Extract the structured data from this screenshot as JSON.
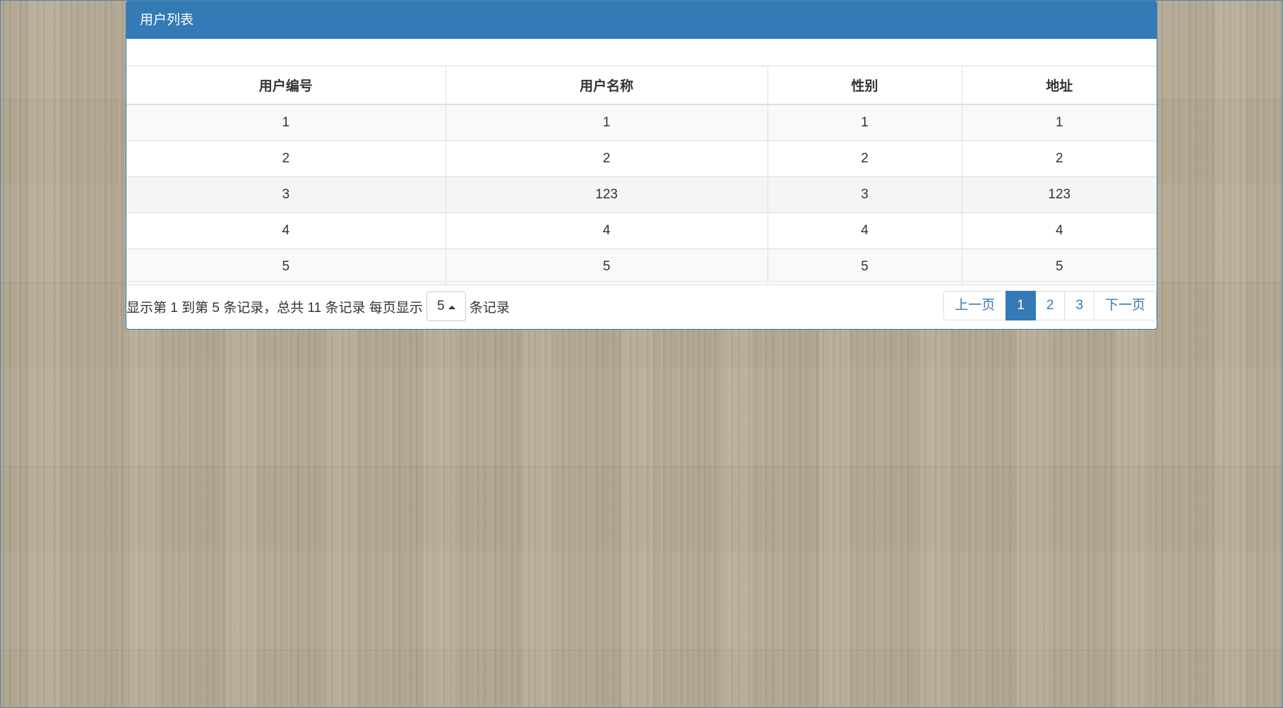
{
  "panel": {
    "title": "用户列表"
  },
  "table": {
    "columns": [
      "用户编号",
      "用户名称",
      "性别",
      "地址"
    ],
    "rows": [
      [
        "1",
        "1",
        "1",
        "1"
      ],
      [
        "2",
        "2",
        "2",
        "2"
      ],
      [
        "3",
        "123",
        "3",
        "123"
      ],
      [
        "4",
        "4",
        "4",
        "4"
      ],
      [
        "5",
        "5",
        "5",
        "5"
      ]
    ]
  },
  "pagination": {
    "summary_text": "显示第 1 到第 5 条记录，总共 11 条记录 每页显示",
    "page_size": "5",
    "suffix_text": "条记录",
    "prev_label": "上一页",
    "pages": [
      "1",
      "2",
      "3"
    ],
    "active_page": "1",
    "next_label": "下一页"
  },
  "colors": {
    "primary": "#337ab7",
    "background": "#b5aa94"
  },
  "icons": {
    "page_size_caret": "caret-up-icon"
  }
}
